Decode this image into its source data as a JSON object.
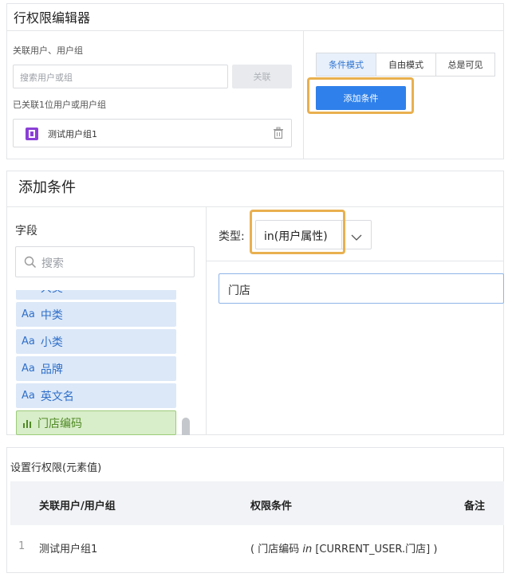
{
  "editor": {
    "title": "行权限编辑器",
    "assoc_label": "关联用户、用户组",
    "search_placeholder": "搜索用户或组",
    "link_button": "关联",
    "linked_count_text": "已关联1位用户或用户组",
    "linked_item": "测试用户组1",
    "modes": [
      "条件模式",
      "自由模式",
      "总是可见"
    ],
    "add_condition_button": "添加条件"
  },
  "add_condition": {
    "title": "添加条件",
    "field_label": "字段",
    "search_placeholder": "搜索",
    "type_label": "类型:",
    "type_value": "in(用户属性)",
    "value_input": "门店",
    "fields": [
      {
        "tag": "Aa",
        "name": "大类"
      },
      {
        "tag": "Aa",
        "name": "中类"
      },
      {
        "tag": "Aa",
        "name": "小类"
      },
      {
        "tag": "Aa",
        "name": "品牌"
      },
      {
        "tag": "Aa",
        "name": "英文名"
      },
      {
        "tag": "bar-chart",
        "name": "门店编码"
      }
    ]
  },
  "settings": {
    "title": "设置行权限(元素值)",
    "columns": [
      "关联用户/用户组",
      "权限条件",
      "备注"
    ],
    "rows": [
      {
        "index": "1",
        "user": "测试用户组1",
        "cond_open": "( 门店编码 ",
        "cond_op": "in",
        "cond_close": " [CURRENT_USER.门店] )",
        "note": ""
      }
    ]
  },
  "colors": {
    "accent": "#2f80ea",
    "highlight": "#e9b04f",
    "field_bg": "#dce8f8",
    "field_active_bg": "#d8edc9"
  }
}
